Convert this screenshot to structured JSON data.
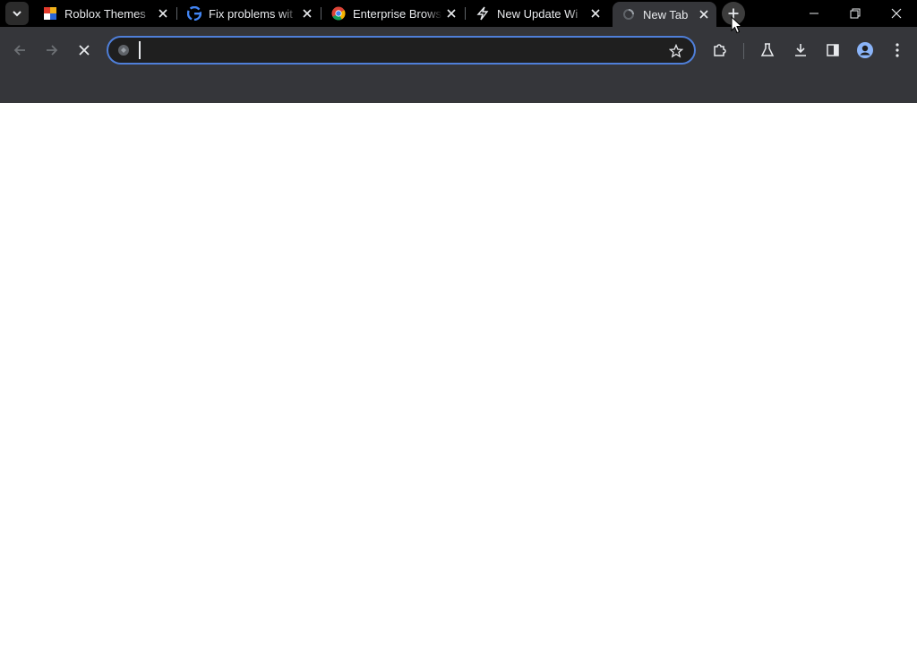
{
  "tabs": [
    {
      "title": "Roblox Themes",
      "favicon": "roblox-favicon",
      "active": false
    },
    {
      "title": "Fix problems wit",
      "favicon": "google-favicon",
      "active": false
    },
    {
      "title": "Enterprise Brows",
      "favicon": "chrome-favicon",
      "active": false
    },
    {
      "title": "New Update Wi",
      "favicon": "lightning-favicon",
      "active": false
    },
    {
      "title": "New Tab",
      "favicon": "loading-favicon",
      "active": true
    }
  ],
  "omnibox": {
    "value": "",
    "placeholder": ""
  },
  "colors": {
    "titlebar": "#000000",
    "toolbar": "#35363a",
    "omnibox_border": "#4f7fd9",
    "content": "#ffffff",
    "avatar": "#8ab4f8"
  }
}
